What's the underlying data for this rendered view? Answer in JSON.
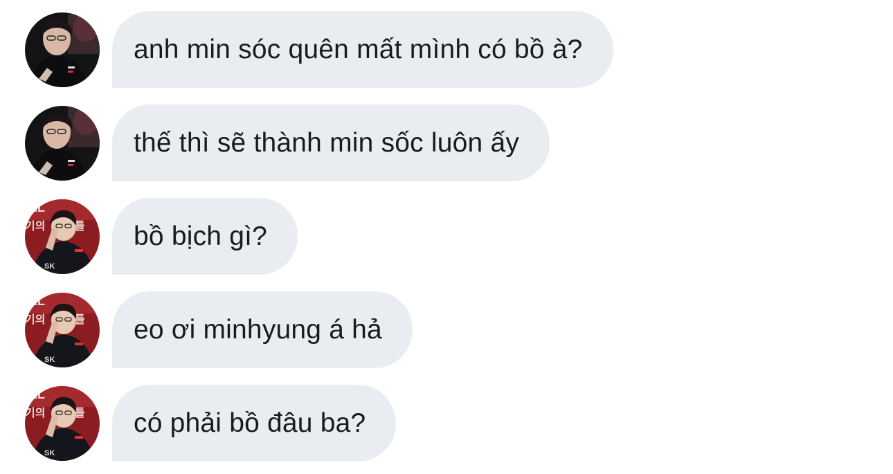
{
  "conversation": {
    "messages": [
      {
        "text": "anh min sóc quên mất mình có bồ à?",
        "avatar": "avatar-dark-photo"
      },
      {
        "text": "thế thì sẽ thành min sốc luôn ấy",
        "avatar": "avatar-dark-photo"
      },
      {
        "text": "bồ bịch gì?",
        "avatar": "avatar-red-photo"
      },
      {
        "text": "eo ơi minhyung á hả",
        "avatar": "avatar-red-photo"
      },
      {
        "text": "có phải bồ đâu ba?",
        "avatar": "avatar-red-photo"
      }
    ]
  },
  "colors": {
    "bubble": "#e9edf1",
    "text": "#1b1b1d",
    "background": "#ffffff"
  }
}
